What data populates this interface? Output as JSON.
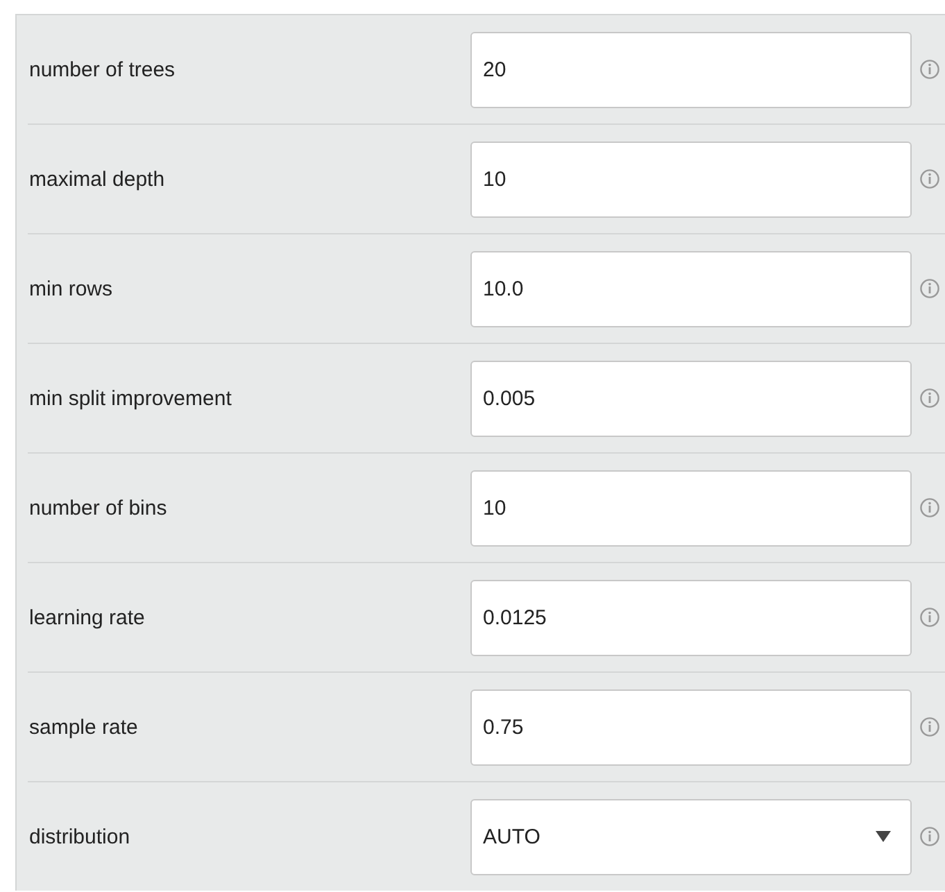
{
  "fields": [
    {
      "label": "number of trees",
      "kind": "text",
      "value": "20"
    },
    {
      "label": "maximal depth",
      "kind": "text",
      "value": "10"
    },
    {
      "label": "min rows",
      "kind": "text",
      "value": "10.0"
    },
    {
      "label": "min split improvement",
      "kind": "text",
      "value": "0.005"
    },
    {
      "label": "number of bins",
      "kind": "text",
      "value": "10"
    },
    {
      "label": "learning rate",
      "kind": "text",
      "value": "0.0125"
    },
    {
      "label": "sample rate",
      "kind": "text",
      "value": "0.75"
    },
    {
      "label": "distribution",
      "kind": "select",
      "value": "AUTO"
    }
  ]
}
